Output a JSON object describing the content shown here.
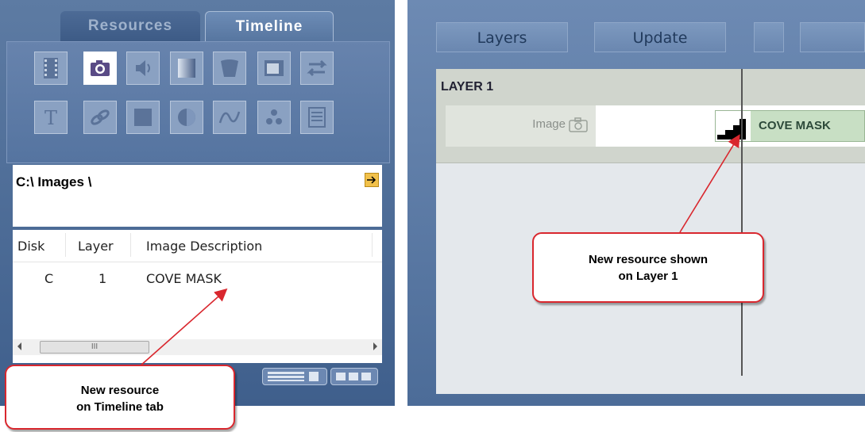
{
  "tabs": [
    {
      "label": "Resources",
      "active": false
    },
    {
      "label": "Timeline",
      "active": true
    }
  ],
  "toolbar": {
    "icons": [
      "film-icon",
      "camera-icon",
      "speaker-icon",
      "gradient-icon",
      "shape-icon",
      "window-icon",
      "swap-icon",
      "text-icon",
      "link-icon",
      "square-icon",
      "circle-icon",
      "wave-icon",
      "dots-icon",
      "list-icon"
    ],
    "selected": "camera-icon"
  },
  "path": {
    "value": "C:\\ Images \\"
  },
  "resource_list": {
    "columns": [
      "Disk",
      "Layer",
      "Image Description"
    ],
    "rows": [
      {
        "disk": "C",
        "layer": "1",
        "description": "COVE MASK"
      }
    ],
    "scroll_glyph": "III"
  },
  "right": {
    "buttons": [
      "Layers",
      "Update"
    ],
    "layer": {
      "title": "LAYER 1",
      "track_label": "Image",
      "clip_label": "COVE MASK"
    }
  },
  "callouts": {
    "layer": [
      "New resource shown",
      "on Layer 1"
    ],
    "timeline": [
      "New resource",
      "on Timeline tab"
    ]
  },
  "colors": {
    "panel_blue": "#4f6f9c",
    "callout_border": "#d9272e",
    "clip_green": "#c8dfc4"
  }
}
